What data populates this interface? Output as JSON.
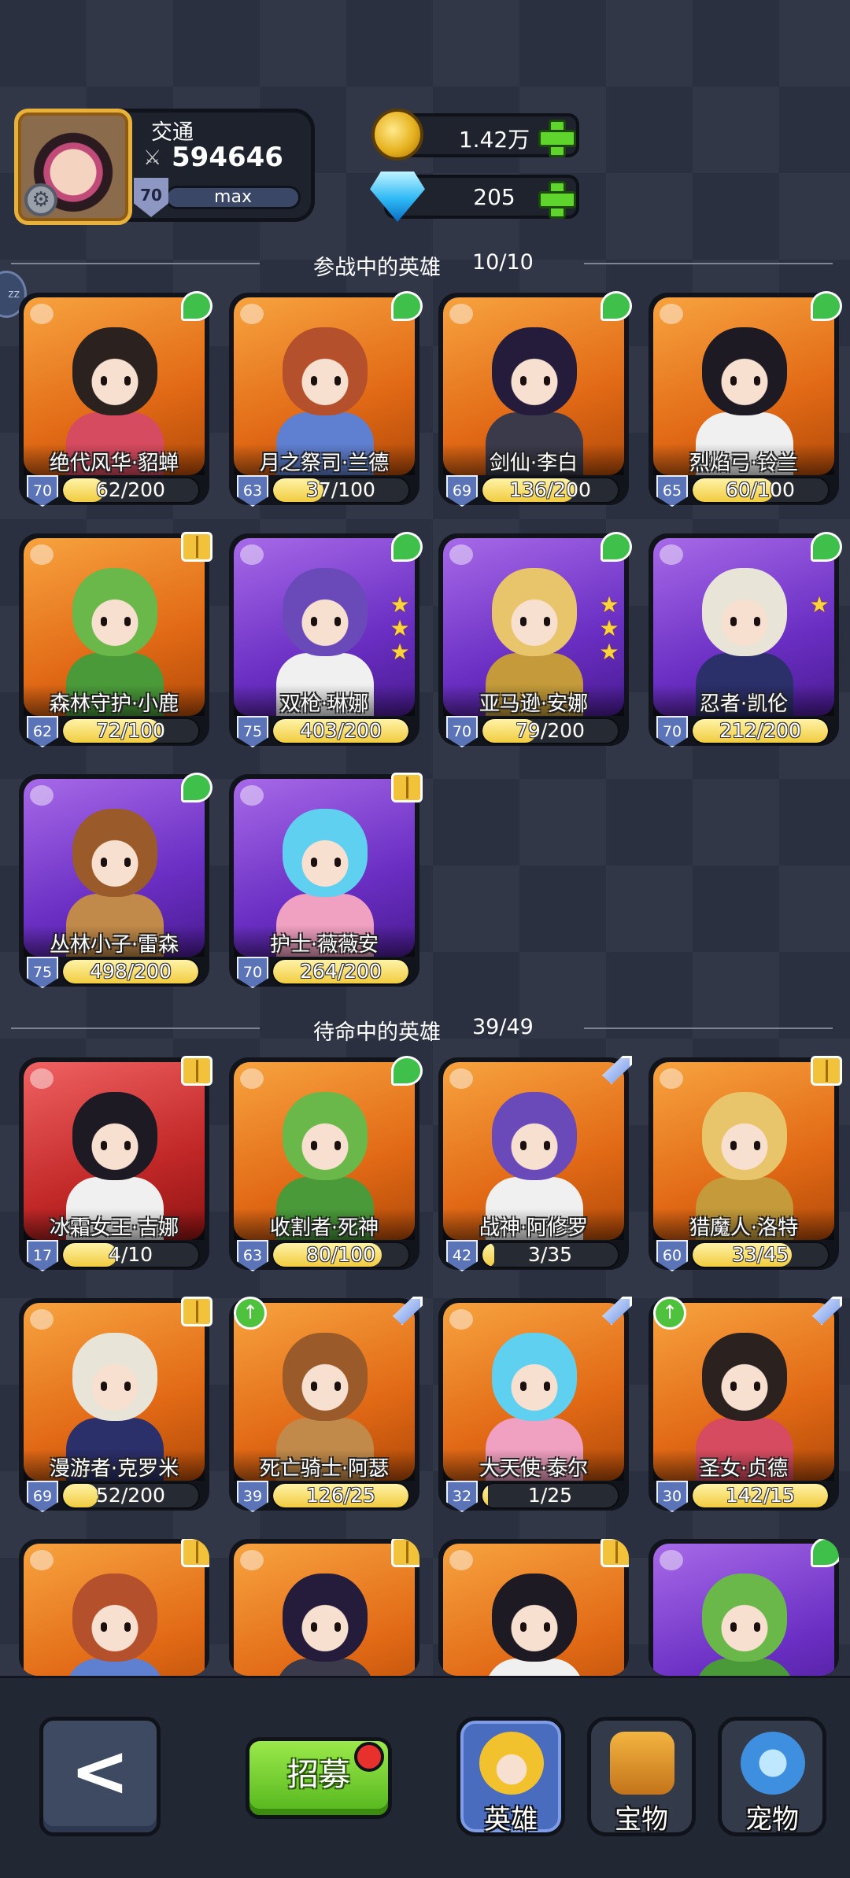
{
  "player": {
    "name": "交通",
    "power_icon": "crossed-swords-icon",
    "power": "594646",
    "level": "70",
    "exp_label": "max"
  },
  "resources": {
    "gold": "1.42万",
    "gems": "205"
  },
  "sections": {
    "active_title": "参战中的英雄",
    "active_count": "10/10",
    "standby_title": "待命中的英雄",
    "standby_count": "39/49"
  },
  "active_heroes": [
    {
      "name": "绝代风华·貂蝉",
      "level": "70",
      "progress": "62/200",
      "fill": 0.31,
      "badge": "leaf",
      "bg": "orange",
      "stars": 0
    },
    {
      "name": "月之祭司·兰德",
      "level": "63",
      "progress": "37/100",
      "fill": 0.37,
      "badge": "leaf",
      "bg": "orange",
      "stars": 0
    },
    {
      "name": "剑仙·李白",
      "level": "69",
      "progress": "136/200",
      "fill": 0.68,
      "badge": "leaf",
      "bg": "orange",
      "stars": 0
    },
    {
      "name": "烈焰弓·铃兰",
      "level": "65",
      "progress": "60/100",
      "fill": 0.6,
      "badge": "leaf",
      "bg": "orange",
      "stars": 0
    },
    {
      "name": "森林守护·小鹿",
      "level": "62",
      "progress": "72/100",
      "fill": 0.72,
      "badge": "book",
      "bg": "orange",
      "stars": 0
    },
    {
      "name": "双枪·琳娜",
      "level": "75",
      "progress": "403/200",
      "fill": 1,
      "badge": "leaf",
      "bg": "purple",
      "stars": 3
    },
    {
      "name": "亚马逊·安娜",
      "level": "70",
      "progress": "79/200",
      "fill": 0.4,
      "badge": "leaf",
      "bg": "purple",
      "stars": 3
    },
    {
      "name": "忍者·凯伦",
      "level": "70",
      "progress": "212/200",
      "fill": 1,
      "badge": "leaf",
      "bg": "purple",
      "stars": 1
    },
    {
      "name": "丛林小子·雷森",
      "level": "75",
      "progress": "498/200",
      "fill": 1,
      "badge": "leaf",
      "bg": "purple",
      "stars": 0
    },
    {
      "name": "护士·薇薇安",
      "level": "70",
      "progress": "264/200",
      "fill": 1,
      "badge": "book",
      "bg": "purple",
      "stars": 0
    }
  ],
  "standby_heroes": [
    {
      "name": "冰霜女王·吉娜",
      "level": "17",
      "progress": "4/10",
      "fill": 0.4,
      "badge": "book",
      "bg": "red",
      "stars": 0
    },
    {
      "name": "收割者·死神",
      "level": "63",
      "progress": "80/100",
      "fill": 0.8,
      "badge": "leaf",
      "bg": "orange",
      "stars": 0
    },
    {
      "name": "战神·阿修罗",
      "level": "42",
      "progress": "3/35",
      "fill": 0.09,
      "badge": "sword",
      "bg": "orange",
      "stars": 0
    },
    {
      "name": "猎魔人·洛特",
      "level": "60",
      "progress": "33/45",
      "fill": 0.73,
      "badge": "book",
      "bg": "orange",
      "stars": 0
    },
    {
      "name": "漫游者·克罗米",
      "level": "69",
      "progress": "52/200",
      "fill": 0.26,
      "badge": "book",
      "bg": "orange",
      "stars": 0
    },
    {
      "name": "死亡骑士·阿瑟",
      "level": "39",
      "progress": "126/25",
      "fill": 1,
      "badge": "sword",
      "upgrade": true,
      "bg": "orange",
      "stars": 0
    },
    {
      "name": "大天使·泰尔",
      "level": "32",
      "progress": "1/25",
      "fill": 0.04,
      "badge": "sword",
      "bg": "orange",
      "stars": 0
    },
    {
      "name": "圣女·贞德",
      "level": "30",
      "progress": "142/15",
      "fill": 1,
      "badge": "sword",
      "upgrade": true,
      "bg": "orange",
      "stars": 0
    },
    {
      "name": "",
      "level": "",
      "progress": "",
      "fill": 0,
      "badge": "book",
      "bg": "orange",
      "stars": 0
    },
    {
      "name": "",
      "level": "",
      "progress": "",
      "fill": 0,
      "badge": "book",
      "bg": "orange",
      "stars": 0
    },
    {
      "name": "",
      "level": "",
      "progress": "",
      "fill": 0,
      "badge": "book",
      "bg": "orange",
      "stars": 0
    },
    {
      "name": "",
      "level": "",
      "progress": "",
      "fill": 0,
      "badge": "leaf",
      "bg": "purple",
      "stars": 0
    }
  ],
  "bottom": {
    "back_icon": "chevron-left-icon",
    "back_glyph": "<",
    "recruit_label": "招募",
    "tabs": [
      {
        "label": "英雄",
        "icon": "hero-icon",
        "active": true
      },
      {
        "label": "宝物",
        "icon": "treasure-icon",
        "active": false
      },
      {
        "label": "宠物",
        "icon": "pet-icon",
        "active": false
      }
    ]
  },
  "colors": {
    "orange_card": "#e26a16",
    "purple_card": "#6b2fc4",
    "red_card": "#c22828",
    "progress_fill": "#f1cc3f",
    "accent_green": "#5fd42c"
  }
}
